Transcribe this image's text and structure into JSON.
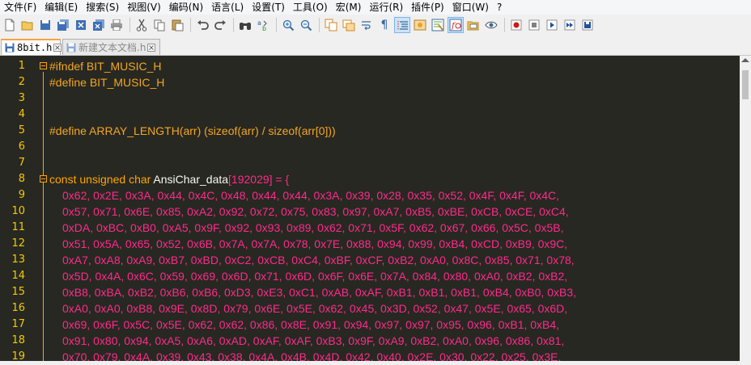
{
  "menu": [
    "文件(F)",
    "编辑(E)",
    "搜索(S)",
    "视图(V)",
    "编码(N)",
    "语言(L)",
    "设置(T)",
    "工具(O)",
    "宏(M)",
    "运行(R)",
    "插件(P)",
    "窗口(W)",
    "?"
  ],
  "tabs": [
    {
      "label": "8bit.h"
    },
    {
      "label": "新建文本文档.h"
    }
  ],
  "line_numbers": [
    "1",
    "2",
    "3",
    "4",
    "5",
    "6",
    "7",
    "8",
    "9",
    "10",
    "11",
    "12",
    "13",
    "14",
    "15",
    "16",
    "17",
    "18",
    "19"
  ],
  "code": {
    "l1": "#ifndef BIT_MUSIC_H",
    "l2": "#define BIT_MUSIC_H",
    "l5": "#define ARRAY_LENGTH(arr) (sizeof(arr) / sizeof(arr[0]))",
    "l8_kw": "const unsigned char",
    "l8_id": " AnsiChar_data",
    "l8_br": "[192029] = {",
    "rows": [
      "0x62, 0x2E, 0x3A, 0x44, 0x4C, 0x48, 0x44, 0x44, 0x3A, 0x39, 0x28, 0x35, 0x52, 0x4F, 0x4F, 0x4C,",
      "0x57, 0x71, 0x6E, 0x85, 0xA2, 0x92, 0x72, 0x75, 0x83, 0x97, 0xA7, 0xB5, 0xBE, 0xCB, 0xCE, 0xC4,",
      "0xDA, 0xBC, 0xB0, 0xA5, 0x9F, 0x92, 0x93, 0x89, 0x62, 0x71, 0x5F, 0x62, 0x67, 0x66, 0x5C, 0x5B,",
      "0x51, 0x5A, 0x65, 0x52, 0x6B, 0x7A, 0x7A, 0x78, 0x7E, 0x88, 0x94, 0x99, 0xB4, 0xCD, 0xB9, 0x9C,",
      "0xA7, 0xA8, 0xA9, 0xB7, 0xBD, 0xC2, 0xCB, 0xC4, 0xBF, 0xCF, 0xB2, 0xA0, 0x8C, 0x85, 0x71, 0x78,",
      "0x5D, 0x4A, 0x6C, 0x59, 0x69, 0x6D, 0x71, 0x6D, 0x6F, 0x6E, 0x7A, 0x84, 0x80, 0xA0, 0xB2, 0xB2,",
      "0xB8, 0xBA, 0xB2, 0xB6, 0xB6, 0xD3, 0xE3, 0xC1, 0xAB, 0xAF, 0xB1, 0xB1, 0xB1, 0xB4, 0xB0, 0xB3,",
      "0xA0, 0xA0, 0xB8, 0x9E, 0x8D, 0x79, 0x6E, 0x5E, 0x62, 0x45, 0x3D, 0x52, 0x47, 0x5E, 0x65, 0x6D,",
      "0x69, 0x6F, 0x5C, 0x5E, 0x62, 0x62, 0x86, 0x8E, 0x91, 0x94, 0x97, 0x97, 0x95, 0x96, 0xB1, 0xB4,",
      "0x91, 0x80, 0x94, 0xA5, 0xA6, 0xAD, 0xAF, 0xAF, 0xB3, 0x9F, 0xA9, 0xB2, 0xA0, 0x96, 0x86, 0x81,",
      "0x70, 0x79, 0x4A, 0x39, 0x43, 0x38, 0x4A, 0x4B, 0x4D, 0x42, 0x40, 0x2E, 0x30, 0x22, 0x25, 0x3E,"
    ]
  },
  "colors": {
    "editor_bg": "#272822",
    "line_number": "#f5c800",
    "preprocessor": "#f5a623",
    "hex": "#ff2a8a"
  }
}
